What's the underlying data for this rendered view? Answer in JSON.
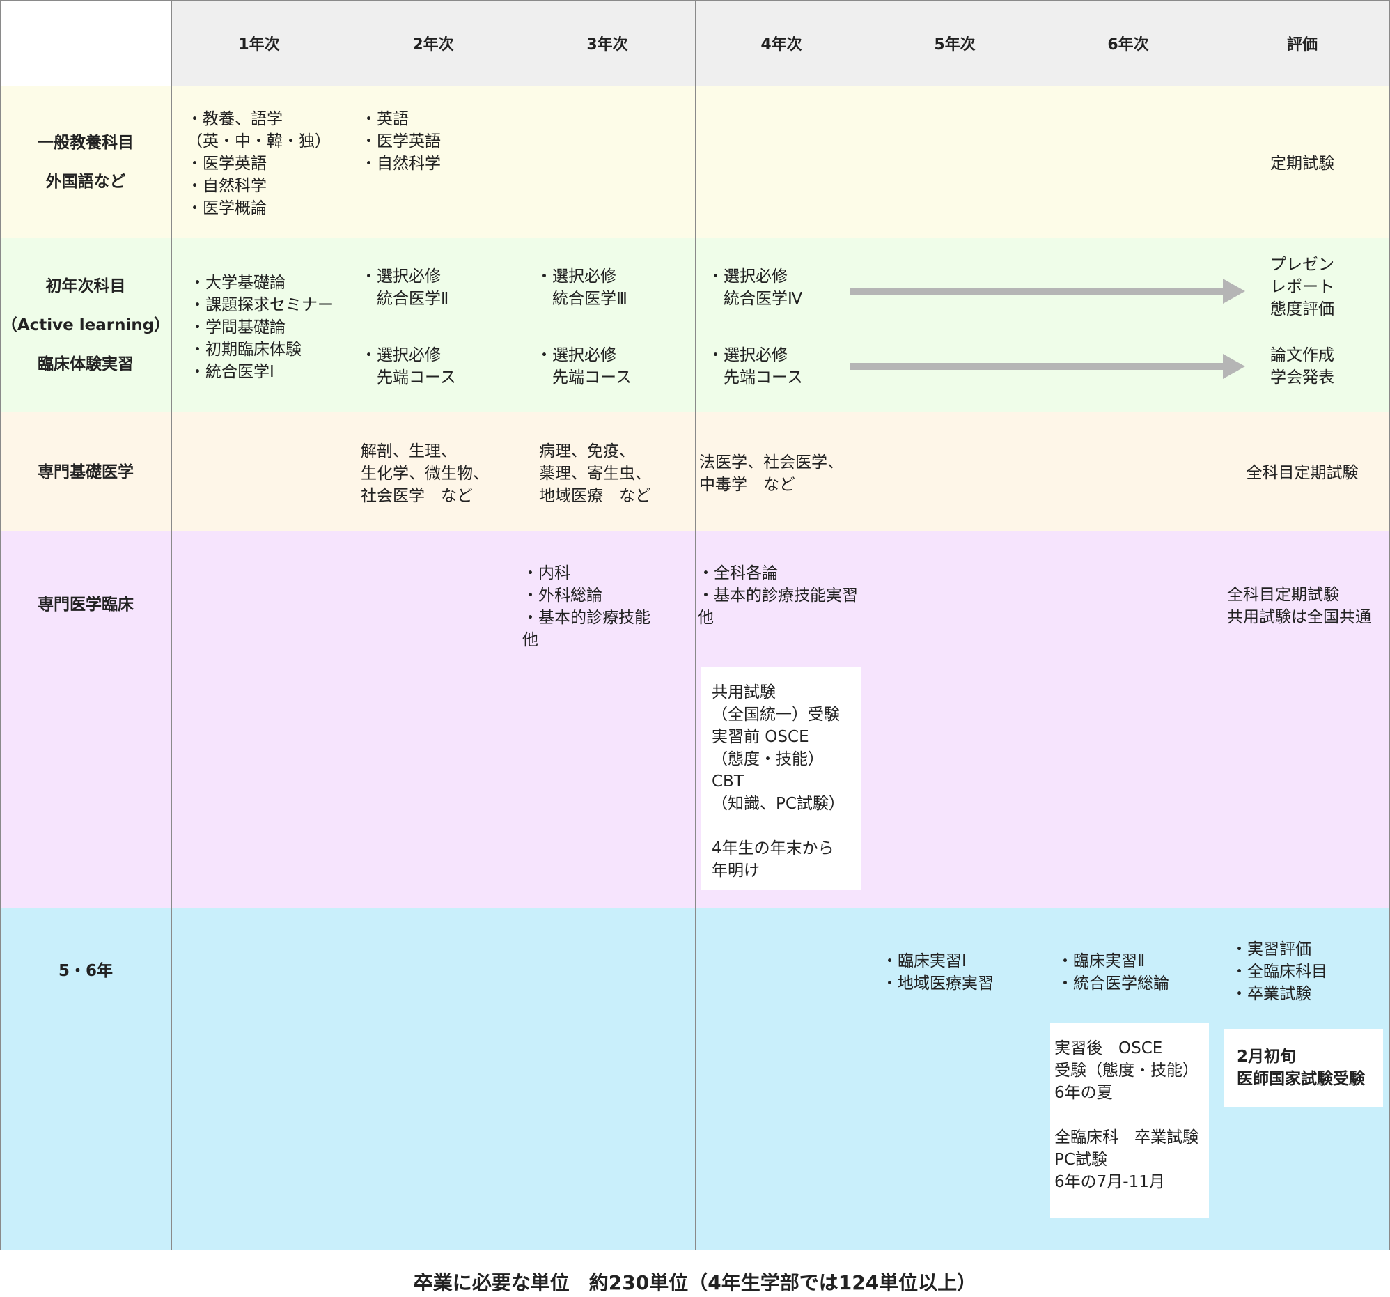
{
  "colors": {
    "header_bg": "#efefef",
    "general_bg": "#fdfce8",
    "first_year_bg": "#effde9",
    "basic_bg": "#fef6e8",
    "clinical_bg": "#f6e4fd",
    "upper_bg": "#c9effb",
    "arrow": "#b5b5b5",
    "grid": "#8a8a8a"
  },
  "header": {
    "corner": "",
    "years": [
      "1年次",
      "2年次",
      "3年次",
      "4年次",
      "5年次",
      "6年次"
    ],
    "evaluation": "評価"
  },
  "rows": {
    "general": {
      "label": [
        "一般教養科目",
        "外国語など"
      ],
      "y1": [
        "・教養、語学",
        "（英・中・韓・独）",
        "・医学英語",
        "・自然科学",
        "・医学概論"
      ],
      "y2": [
        "・英語",
        "・医学英語",
        "・自然科学"
      ],
      "eval": [
        "定期試験"
      ]
    },
    "first_year": {
      "label": [
        "初年次科目",
        "（Active learning）",
        "臨床体験実習"
      ],
      "y1": [
        "・大学基礎論",
        "・課題探求セミナー",
        "・学問基礎論",
        "・初期臨床体験",
        "・統合医学Ⅰ"
      ],
      "y2a": [
        "・選択必修",
        "　統合医学Ⅱ"
      ],
      "y2b": [
        "・選択必修",
        "　先端コース"
      ],
      "y3a": [
        "・選択必修",
        "　統合医学Ⅲ"
      ],
      "y3b": [
        "・選択必修",
        "　先端コース"
      ],
      "y4a": [
        "・選択必修",
        "　統合医学Ⅳ"
      ],
      "y4b": [
        "・選択必修",
        "　先端コース"
      ],
      "eval_a": [
        "プレゼン",
        "レポート",
        "態度評価"
      ],
      "eval_b": [
        "論文作成",
        "学会発表"
      ]
    },
    "basic": {
      "label": [
        "専門基礎医学"
      ],
      "y2": [
        "解剖、生理、",
        "生化学、微生物、",
        "社会医学　など"
      ],
      "y3": [
        "病理、免疫、",
        "薬理、寄生虫、",
        "地域医療　など"
      ],
      "y4": [
        "法医学、社会医学、",
        "中毒学　など"
      ],
      "eval": [
        "全科目定期試験"
      ]
    },
    "clinical": {
      "label": [
        "専門医学臨床"
      ],
      "y3": [
        "・内科",
        "・外科総論",
        "・基本的診療技能",
        "他"
      ],
      "y4": [
        "・全科各論",
        "・基本的診療技能実習",
        "他"
      ],
      "y4_box": [
        "共用試験",
        "（全国統一）受験",
        "実習前 OSCE",
        "（態度・技能）",
        "CBT",
        "（知識、PC試験）",
        "",
        "4年生の年末から",
        "年明け"
      ],
      "eval": [
        "全科目定期試験",
        "共用試験は全国共通"
      ]
    },
    "upper": {
      "label": [
        "5・6年"
      ],
      "y5": [
        "・臨床実習Ⅰ",
        "・地域医療実習"
      ],
      "y6": [
        "・臨床実習Ⅱ",
        "・統合医学総論"
      ],
      "y6_box": [
        "実習後　OSCE",
        "受験（態度・技能）",
        "6年の夏",
        "",
        "全臨床科　卒業試験",
        "PC試験",
        "6年の7月-11月"
      ],
      "eval": [
        "・実習評価",
        "・全臨床科目",
        "・卒業試験"
      ],
      "eval_box": [
        "2月初旬",
        "医師国家試験受験"
      ]
    }
  },
  "footer": "卒業に必要な単位　約230単位（4年生学部では124単位以上）"
}
